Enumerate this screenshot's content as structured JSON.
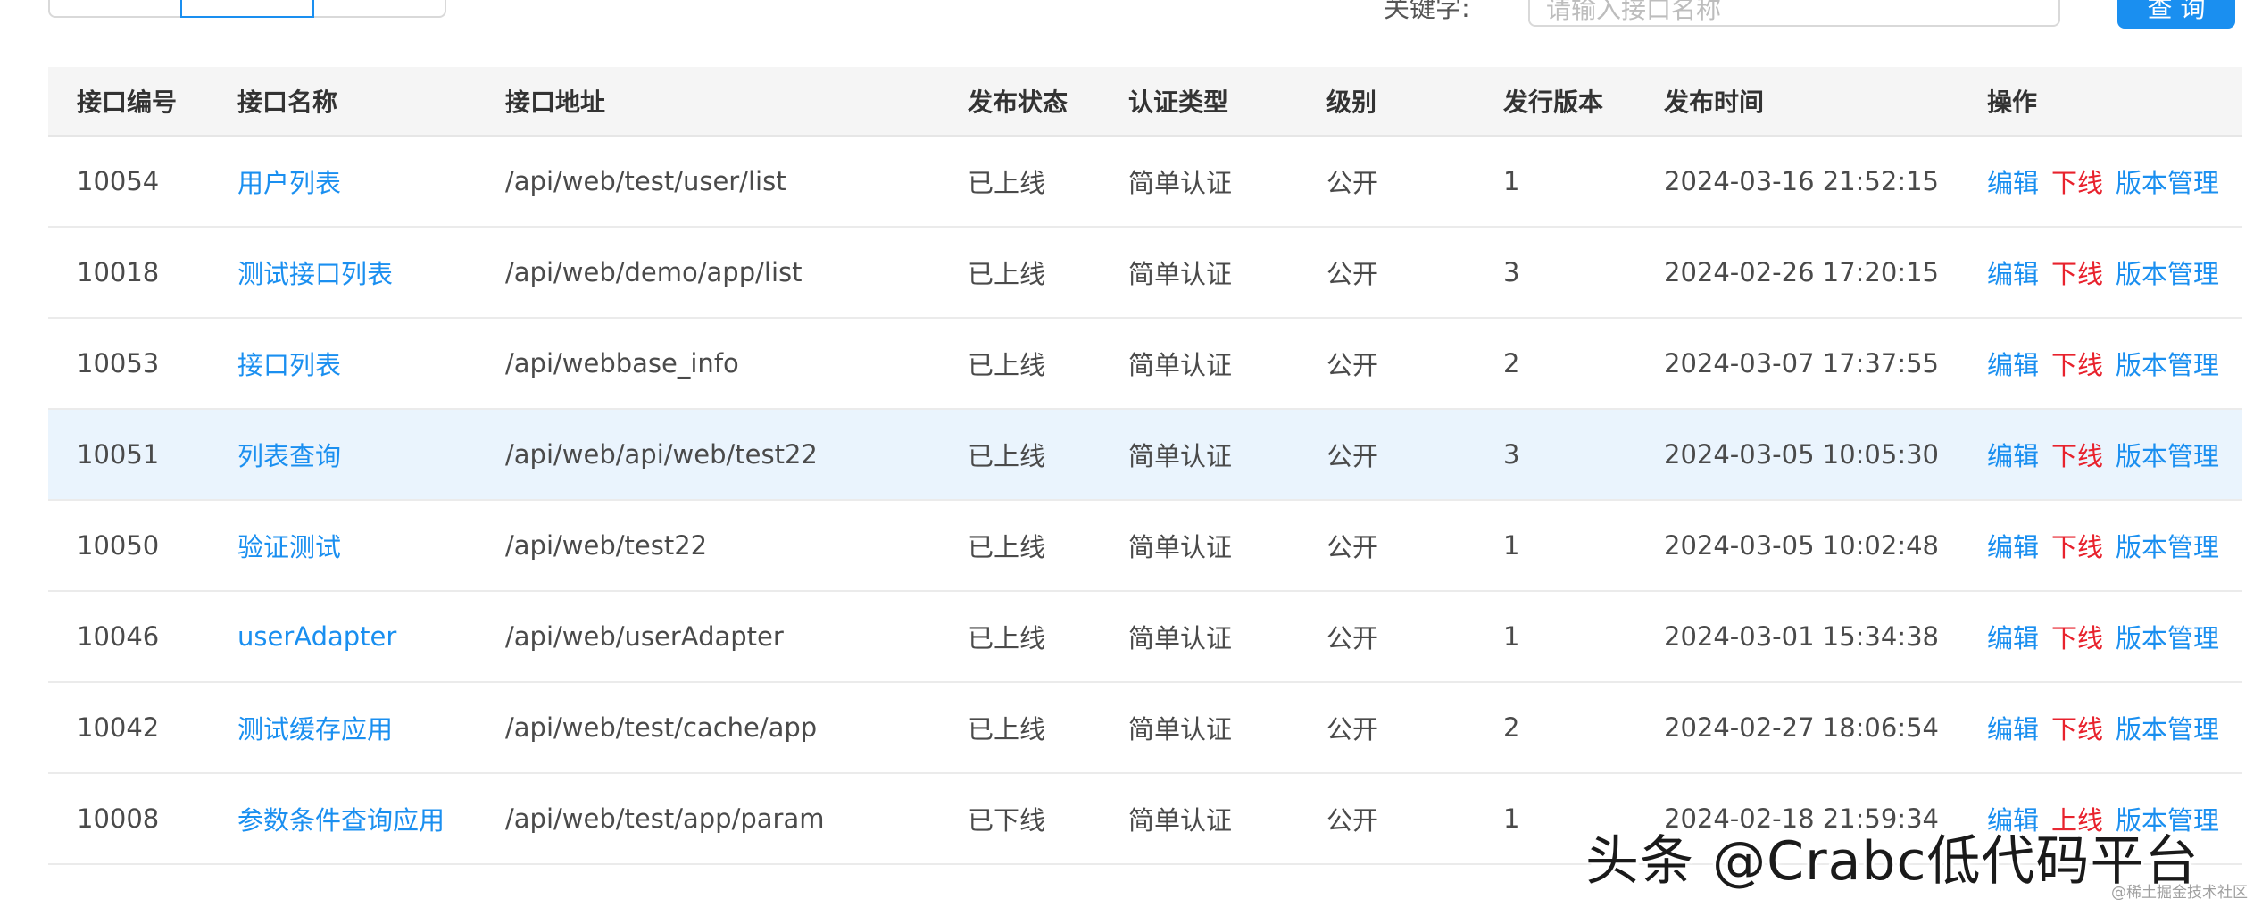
{
  "toolbar": {
    "keyword_label": "关键字:",
    "keyword_placeholder": "请输入接口名称",
    "query_label": "查 询"
  },
  "table": {
    "columns": [
      "接口编号",
      "接口名称",
      "接口地址",
      "发布状态",
      "认证类型",
      "级别",
      "发行版本",
      "发布时间",
      "操作"
    ],
    "rows": [
      {
        "id": "10054",
        "name": "用户列表",
        "path": "/api/web/test/user/list",
        "status": "已上线",
        "auth": "简单认证",
        "level": "公开",
        "version": "1",
        "time": "2024-03-16 21:52:15",
        "ops": [
          "编辑",
          "下线",
          "版本管理"
        ]
      },
      {
        "id": "10018",
        "name": "测试接口列表",
        "path": "/api/web/demo/app/list",
        "status": "已上线",
        "auth": "简单认证",
        "level": "公开",
        "version": "3",
        "time": "2024-02-26 17:20:15",
        "ops": [
          "编辑",
          "下线",
          "版本管理"
        ]
      },
      {
        "id": "10053",
        "name": "接口列表",
        "path": "/api/webbase_info",
        "status": "已上线",
        "auth": "简单认证",
        "level": "公开",
        "version": "2",
        "time": "2024-03-07 17:37:55",
        "ops": [
          "编辑",
          "下线",
          "版本管理"
        ]
      },
      {
        "id": "10051",
        "name": "列表查询",
        "path": "/api/web/api/web/test22",
        "status": "已上线",
        "auth": "简单认证",
        "level": "公开",
        "version": "3",
        "time": "2024-03-05 10:05:30",
        "ops": [
          "编辑",
          "下线",
          "版本管理"
        ]
      },
      {
        "id": "10050",
        "name": "验证测试",
        "path": "/api/web/test22",
        "status": "已上线",
        "auth": "简单认证",
        "level": "公开",
        "version": "1",
        "time": "2024-03-05 10:02:48",
        "ops": [
          "编辑",
          "下线",
          "版本管理"
        ]
      },
      {
        "id": "10046",
        "name": "userAdapter",
        "path": "/api/web/userAdapter",
        "status": "已上线",
        "auth": "简单认证",
        "level": "公开",
        "version": "1",
        "time": "2024-03-01 15:34:38",
        "ops": [
          "编辑",
          "下线",
          "版本管理"
        ]
      },
      {
        "id": "10042",
        "name": "测试缓存应用",
        "path": "/api/web/test/cache/app",
        "status": "已上线",
        "auth": "简单认证",
        "level": "公开",
        "version": "2",
        "time": "2024-02-27 18:06:54",
        "ops": [
          "编辑",
          "下线",
          "版本管理"
        ]
      },
      {
        "id": "10008",
        "name": "参数条件查询应用",
        "path": "/api/web/test/app/param",
        "status": "已下线",
        "auth": "简单认证",
        "level": "公开",
        "version": "1",
        "time": "2024-02-18 21:59:34",
        "ops": [
          "编辑",
          "上线",
          "版本管理"
        ]
      }
    ]
  },
  "watermark": {
    "text": "头条 @Crabc低代码平台",
    "small": "@稀土掘金技术社区"
  },
  "colors": {
    "link": "#1a8ff0",
    "danger": "#e8222d",
    "highlight_row": "#eaf4fd",
    "header_bg": "#f5f5f5"
  }
}
